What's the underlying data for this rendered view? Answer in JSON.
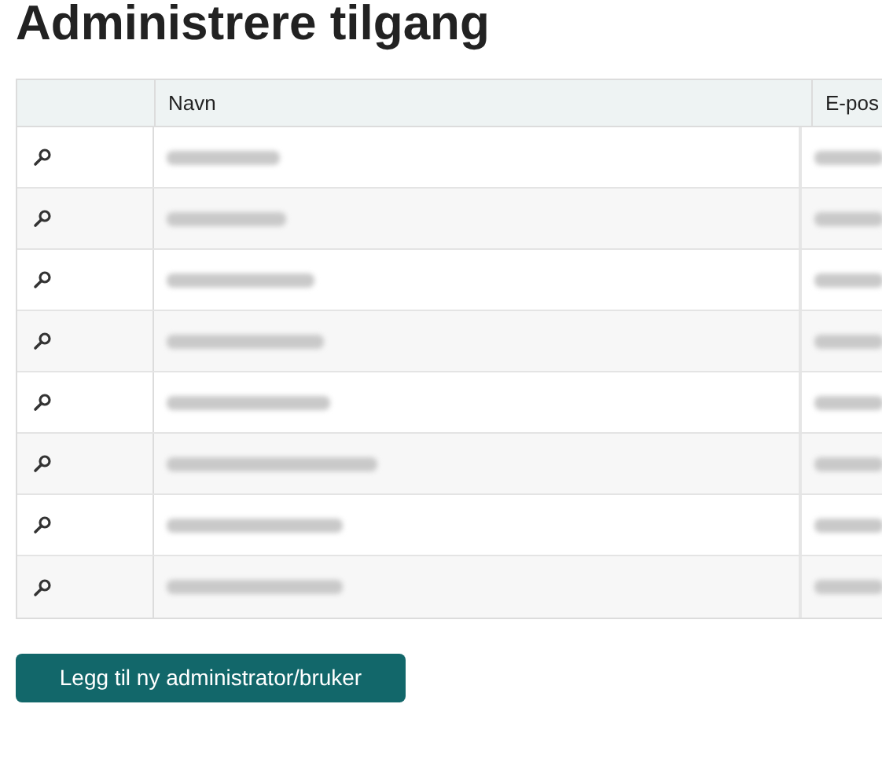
{
  "title": "Administrere tilgang",
  "table": {
    "columns": [
      "Navn",
      "E-pos"
    ],
    "rows": [
      {
        "kind": "blurred"
      },
      {
        "kind": "blurred"
      },
      {
        "kind": "blurred"
      },
      {
        "kind": "blurred"
      },
      {
        "kind": "blurred"
      },
      {
        "kind": "blurred"
      },
      {
        "kind": "blurred"
      },
      {
        "kind": "blurred"
      }
    ]
  },
  "button": "Legg til ny administrator/bruker"
}
